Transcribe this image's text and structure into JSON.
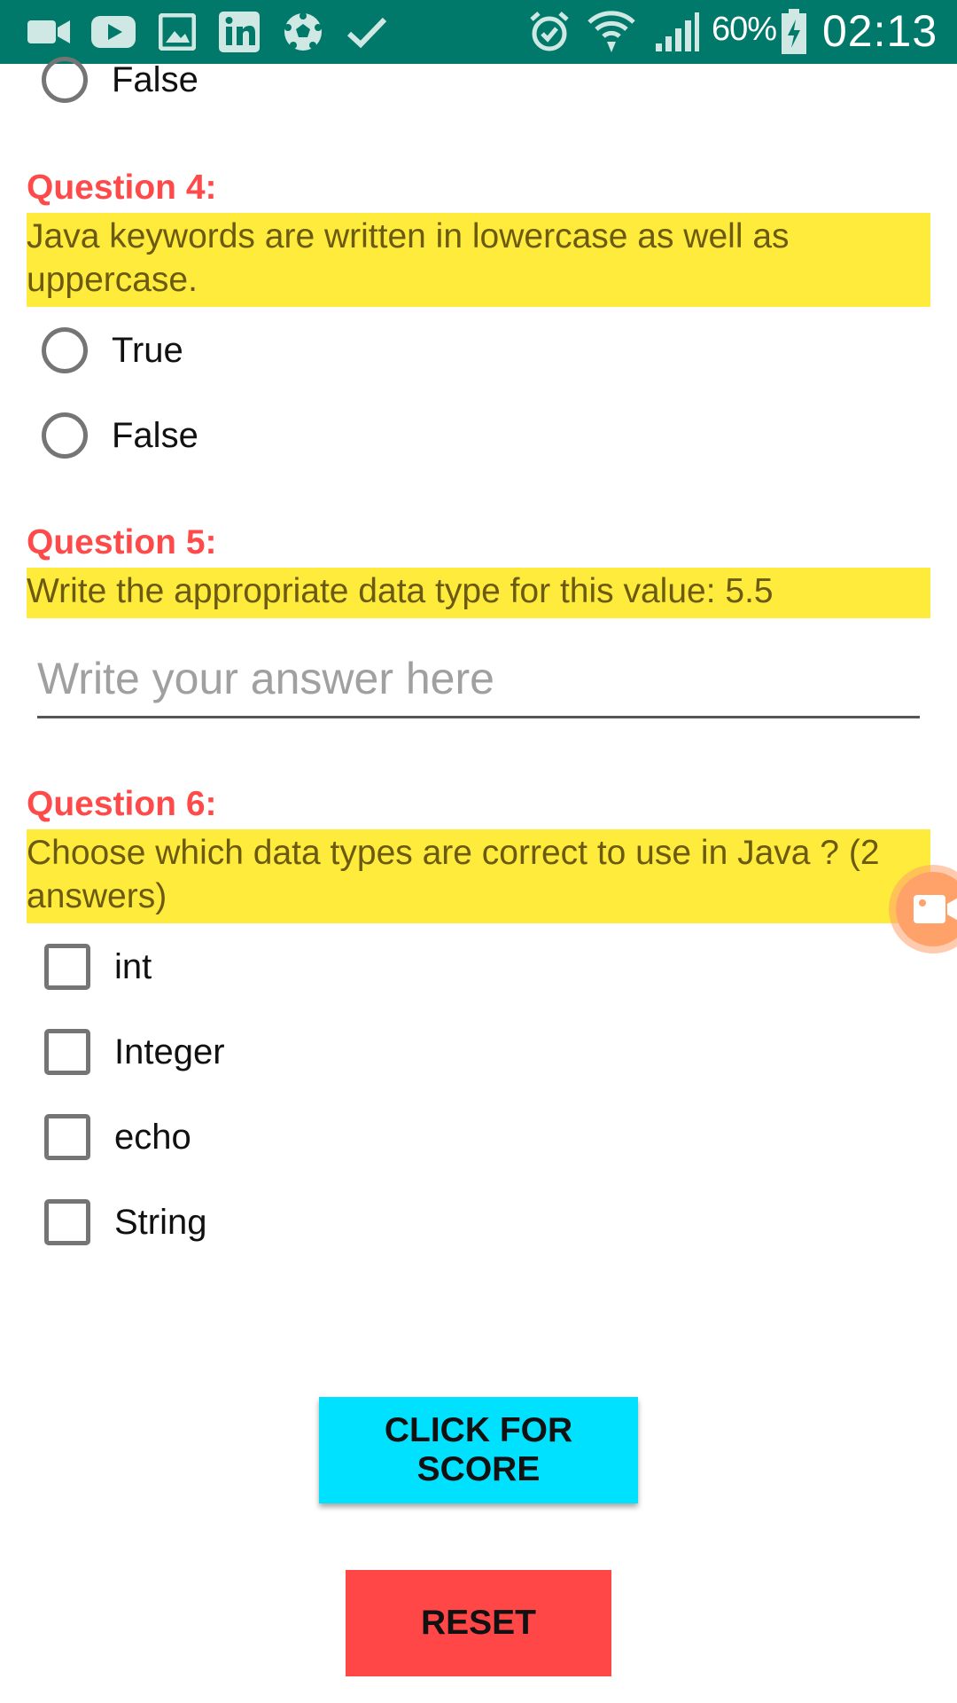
{
  "status_bar": {
    "background": "#00796b",
    "left_icons": [
      "video-call-icon",
      "youtube-icon",
      "gallery-icon",
      "linkedin-icon",
      "soccer-ball-icon",
      "check-icon"
    ],
    "right_icons": [
      "alarm-icon",
      "wifi-icon",
      "cell-signal-icon",
      "battery-charging-icon"
    ],
    "battery_percent": "60%",
    "time": "02:13"
  },
  "quiz": {
    "q3_partial": {
      "option_false": "False"
    },
    "q4": {
      "title": "Question 4:",
      "text": "Java keywords are written in lowercase as well as uppercase.",
      "options": [
        "True",
        "False"
      ]
    },
    "q5": {
      "title": "Question 5:",
      "text": "Write the appropriate data type for this value: 5.5",
      "input_value": "",
      "input_placeholder": "Write your answer here"
    },
    "q6": {
      "title": "Question 6:",
      "text": "Choose which data types are correct to use in Java ? (2 answers)",
      "options": [
        "int",
        "Integer",
        "echo",
        "String"
      ]
    }
  },
  "buttons": {
    "score_label": "CLICK FOR SCORE",
    "reset_label": "RESET"
  },
  "colors": {
    "question_title": "#ff4a4a",
    "question_highlight": "#ffeb3b",
    "score_button": "#00e0ff",
    "reset_button": "#ff4747"
  },
  "overlay": {
    "floating_button_icon": "screen-recorder-icon"
  }
}
